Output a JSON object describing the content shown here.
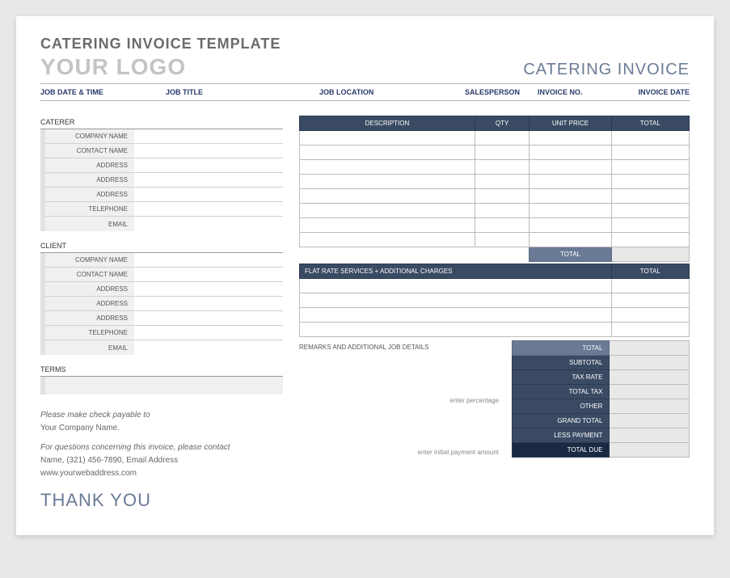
{
  "header": {
    "title": "CATERING INVOICE TEMPLATE",
    "logo": "YOUR LOGO",
    "invoice_label": "CATERING INVOICE"
  },
  "job_header": {
    "date_time": "JOB DATE & TIME",
    "title": "JOB TITLE",
    "location": "JOB LOCATION",
    "salesperson": "SALESPERSON",
    "invoice_no": "INVOICE NO.",
    "invoice_date": "INVOICE DATE"
  },
  "sections": {
    "caterer": "CATERER",
    "client": "CLIENT",
    "terms": "TERMS"
  },
  "fields": {
    "company_name": "COMPANY NAME",
    "contact_name": "CONTACT NAME",
    "address": "ADDRESS",
    "telephone": "TELEPHONE",
    "email": "EMAIL"
  },
  "items_header": {
    "description": "DESCRIPTION",
    "qty": "QTY",
    "unit_price": "UNIT PRICE",
    "total": "TOTAL"
  },
  "flat_header": {
    "main": "FLAT RATE SERVICES + ADDITIONAL CHARGES",
    "total": "TOTAL"
  },
  "remarks_label": "REMARKS AND ADDITIONAL JOB DETAILS",
  "totals": {
    "total": "TOTAL",
    "subtotal": "SUBTOTAL",
    "tax_rate": "TAX RATE",
    "total_tax": "TOTAL TAX",
    "other": "OTHER",
    "grand_total": "GRAND TOTAL",
    "less_payment": "LESS PAYMENT",
    "total_due": "TOTAL DUE"
  },
  "hints": {
    "percentage": "enter percentage",
    "payment": "enter initial payment amount"
  },
  "footer": {
    "payable": "Please make check payable to",
    "company": "Your Company Name.",
    "questions": "For questions concerning this invoice, please contact",
    "contact": "Name, (321) 456-7890, Email Address",
    "website": "www.yourwebaddress.com",
    "thanks": "THANK YOU"
  }
}
